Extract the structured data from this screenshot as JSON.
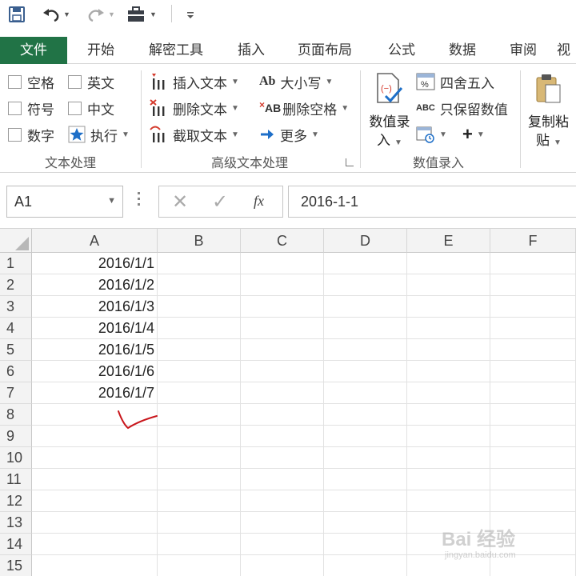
{
  "colors": {
    "accent": "#217346",
    "blue": "#1e6fc8",
    "red_arrow": "#d43a2c",
    "annotation": "#c8151b"
  },
  "qat": {
    "icons": [
      "save-icon",
      "undo-icon",
      "redo-icon",
      "briefcase-icon",
      "customize-icon"
    ]
  },
  "tabs": [
    "文件",
    "开始",
    "解密工具",
    "插入",
    "页面布局",
    "公式",
    "数据",
    "审阅",
    "视"
  ],
  "ribbon": {
    "text_processing": {
      "items": [
        "空格",
        "英文",
        "符号",
        "中文",
        "数字",
        "执行"
      ],
      "label": "文本处理"
    },
    "advanced": {
      "insert": "插入文本",
      "delete": "删除文本",
      "extract": "截取文本",
      "case": "大小写",
      "case_icon": "Ab",
      "delete_space": "删除空格",
      "delete_space_icon": "AB",
      "more": "更多",
      "label": "高级文本处理"
    },
    "numeric": {
      "entry_line1": "数值录",
      "entry_line2": "入",
      "round": "四舍五入",
      "keep_values": "只保留数值",
      "keep_icon": "ABC",
      "plus": "+",
      "label": "数值录入"
    },
    "paste": {
      "line1": "复制粘",
      "line2": "贴"
    }
  },
  "formula_bar": {
    "name_box": "A1",
    "fx": "fx",
    "value": "2016-1-1"
  },
  "grid": {
    "columns": [
      "A",
      "B",
      "C",
      "D",
      "E",
      "F"
    ],
    "rows": [
      "1",
      "2",
      "3",
      "4",
      "5",
      "6",
      "7",
      "8",
      "9",
      "10",
      "11",
      "12",
      "13",
      "14",
      "15"
    ],
    "column_a": [
      "2016/1/1",
      "2016/1/2",
      "2016/1/3",
      "2016/1/4",
      "2016/1/5",
      "2016/1/6",
      "2016/1/7"
    ]
  },
  "watermark": {
    "logo": "Bai 经验",
    "url": "jingyan.baidu.com"
  }
}
